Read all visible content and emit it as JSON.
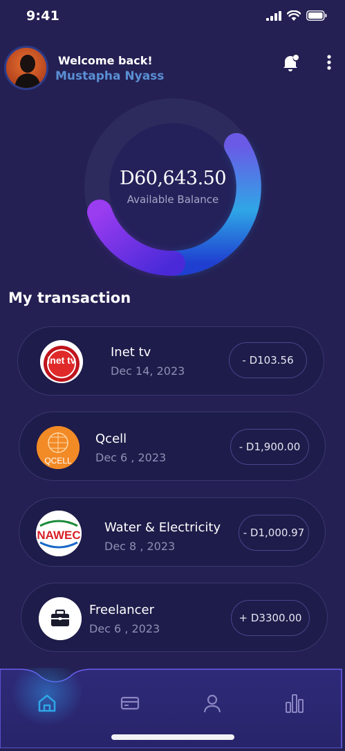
{
  "status": {
    "time": "9:41"
  },
  "header": {
    "welcome": "Welcome back!",
    "user_name": "Mustapha Nyass"
  },
  "balance": {
    "amount": "D60,643.50",
    "label": "Available Balance"
  },
  "section_title": "My transaction",
  "transactions": [
    {
      "name": "Inet tv",
      "date": "Dec 14, 2023",
      "amount": "- D103.56",
      "logo": "inet-tv-logo",
      "logo_text": "inet tv"
    },
    {
      "name": "Qcell",
      "date": "Dec 6 , 2023",
      "amount": "- D1,900.00",
      "logo": "qcell-logo",
      "logo_text": "QCELL"
    },
    {
      "name": "Water & Electricity",
      "date": "Dec 8 , 2023",
      "amount": "- D1,000.97",
      "logo": "nawec-logo",
      "logo_text": "NAWEC"
    },
    {
      "name": "Freelancer",
      "date": "Dec 6 , 2023",
      "amount": "+ D3300.00",
      "logo": "briefcase-icon"
    }
  ],
  "nav": [
    {
      "icon": "home-icon",
      "active": true
    },
    {
      "icon": "card-icon",
      "active": false
    },
    {
      "icon": "profile-icon",
      "active": false
    },
    {
      "icon": "stats-icon",
      "active": false
    }
  ],
  "colors": {
    "background": "#242053",
    "card": "#1e1c4a",
    "accent": "#2fa6e6",
    "username": "#5a8fd4"
  }
}
